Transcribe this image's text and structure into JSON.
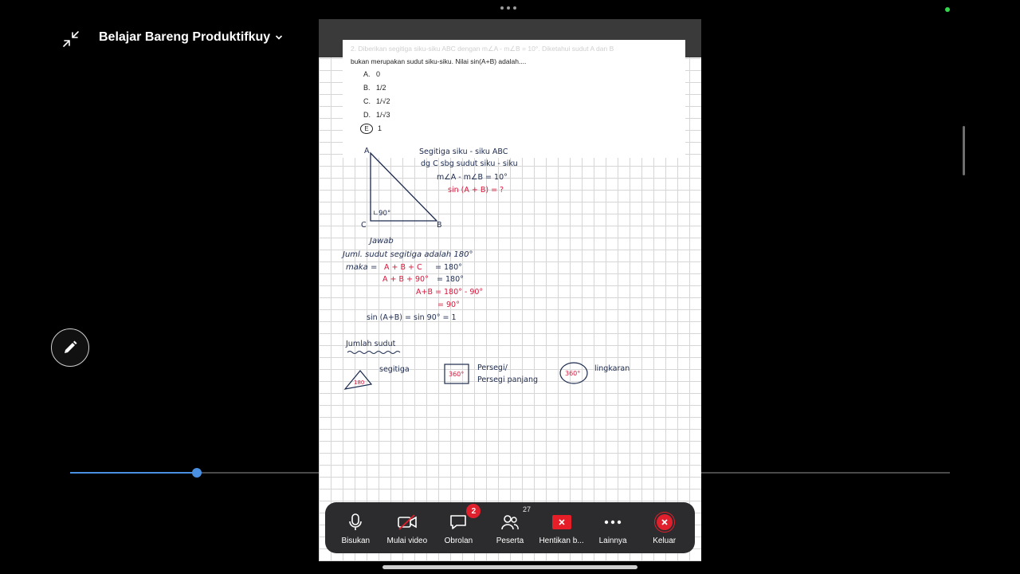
{
  "header": {
    "meeting_title": "Belajar Bareng Produktifkuy"
  },
  "document": {
    "question_line1": "2. Diberikan segitiga siku-siku ABC dengan m∠A - m∠B = 10°. Diketahui sudut A dan B",
    "question_line2": "bukan merupakan sudut siku-siku. Nilai sin(A+B) adalah....",
    "options": [
      {
        "letter": "A.",
        "text": "0"
      },
      {
        "letter": "B.",
        "text": "1/2"
      },
      {
        "letter": "C.",
        "text": "1/√2"
      },
      {
        "letter": "D.",
        "text": "1/√3"
      },
      {
        "letter": "E",
        "text": "1"
      }
    ],
    "handwriting": {
      "vertex_a": "A",
      "vertex_b": "B",
      "vertex_c": "C",
      "right_angle": "∟90°",
      "given_1": "Segitiga siku - siku ABC",
      "given_2": "dg C sbg sudut siku - siku",
      "given_3": "m∠A - m∠B = 10°",
      "asked": "sin (A + B) = ?",
      "answer_title": "Jawab",
      "line1": "Juml. sudut segitiga adalah 180°",
      "line2_prefix": "maka =",
      "line2_red": "A + B + C",
      "line2_suffix": "= 180°",
      "line3_red": "A + B + 90°",
      "line3_suffix": "= 180°",
      "line4": "A+B = 180° - 90°",
      "line5": "= 90°",
      "line6": "sin (A+B) = sin 90° = 1",
      "sum_title": "Jumlah sudut",
      "shape_triangle_value": "180",
      "shape_triangle_label": "segitiga",
      "shape_square_value": "360°",
      "shape_square_label1": "Persegi/",
      "shape_square_label2": "Persegi panjang",
      "shape_circle_value": "360°",
      "shape_circle_label": "lingkaran"
    }
  },
  "playback": {
    "progress": 0.144
  },
  "toolbar": {
    "items": [
      {
        "label": "Bisukan",
        "icon": "microphone-icon"
      },
      {
        "label": "Mulai video",
        "icon": "video-off-icon"
      },
      {
        "label": "Obrolan",
        "icon": "chat-icon",
        "badge": "2"
      },
      {
        "label": "Peserta",
        "icon": "participants-icon",
        "count": "27"
      },
      {
        "label": "Hentikan b...",
        "icon": "stop-share-icon"
      },
      {
        "label": "Lainnya",
        "icon": "more-icon"
      },
      {
        "label": "Keluar",
        "icon": "leave-icon"
      }
    ]
  },
  "colors": {
    "accent_blue": "#4a90e2",
    "danger_red": "#e0202c",
    "ink_blue": "#1c2a4e",
    "ink_red": "#d6173a"
  }
}
